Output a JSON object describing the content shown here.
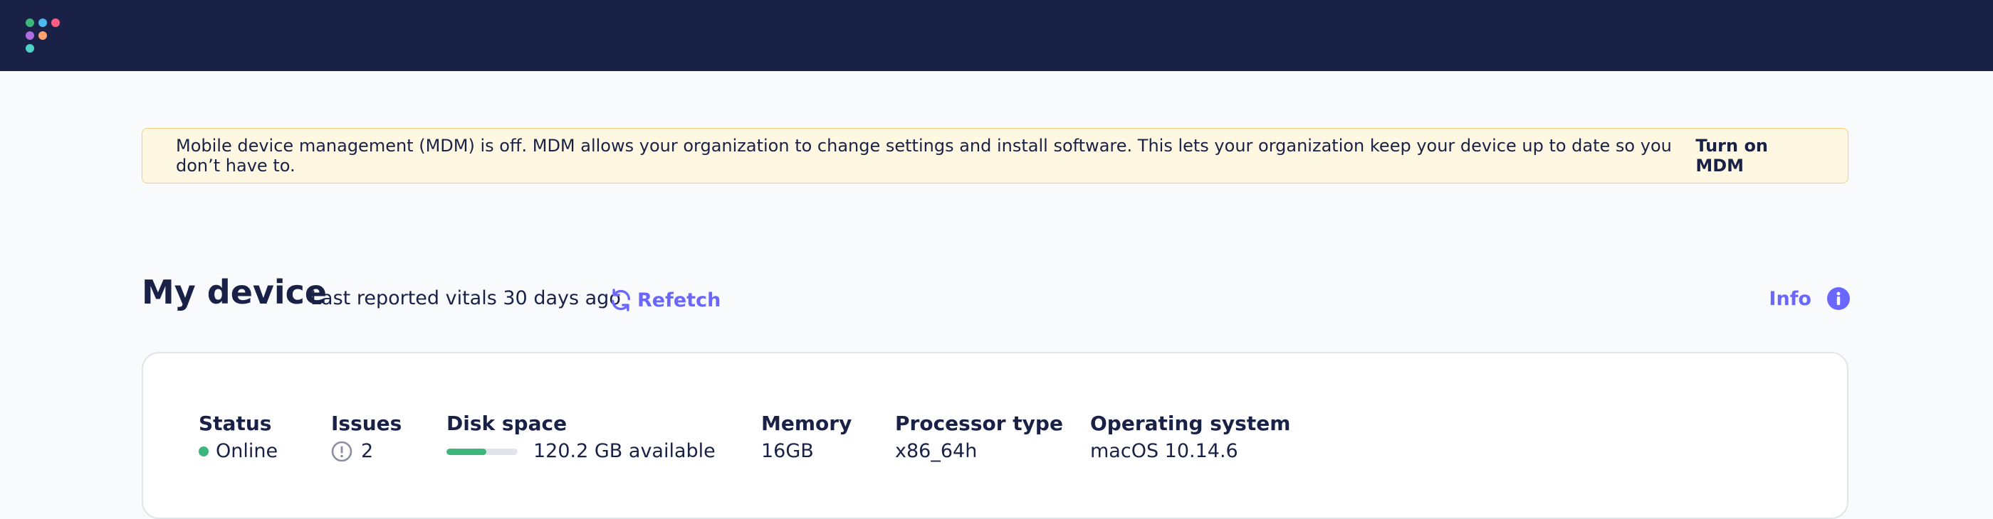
{
  "logo": {
    "colors": [
      "#3db67b",
      "#4fd2e6",
      "#ff5c83",
      "#ae6ddf",
      "#ffa270",
      "#4fd2e6"
    ]
  },
  "banner": {
    "text": "Mobile device management (MDM) is off. MDM allows your organization to change settings and install software. This lets your organization keep your device up to date so you don’t have to.",
    "action_label": "Turn on MDM"
  },
  "header": {
    "title": "My device",
    "last_reported": "Last reported vitals 30 days ago",
    "refetch_label": "Refetch",
    "info_label": "Info"
  },
  "vitals": {
    "status": {
      "label": "Status",
      "value": "Online",
      "color": "#3db67b"
    },
    "issues": {
      "label": "Issues",
      "value": "2"
    },
    "disk_space": {
      "label": "Disk space",
      "value": "120.2 GB available",
      "used_fraction": 0.56
    },
    "memory": {
      "label": "Memory",
      "value": "16GB"
    },
    "processor": {
      "label": "Processor type",
      "value": "x86_64h"
    },
    "os": {
      "label": "Operating system",
      "value": "macOS 10.14.6"
    }
  },
  "colors": {
    "nav": "#192147",
    "accent": "#6a67fe",
    "banner_bg": "#fef7e1",
    "success": "#3db67b"
  }
}
